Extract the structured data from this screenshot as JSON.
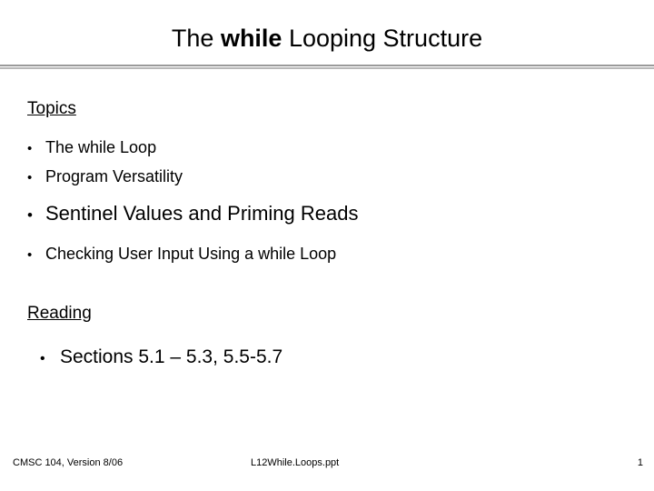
{
  "slide": {
    "title": {
      "before": "The ",
      "emphasis": "while",
      "after": " Looping Structure"
    },
    "topics_heading": "Topics",
    "topics": [
      {
        "bullet": "•",
        "text": "The while Loop",
        "size": "normal"
      },
      {
        "bullet": "•",
        "text": "Program Versatility",
        "size": "normal"
      },
      {
        "bullet": "•",
        "text": "Sentinel Values and Priming Reads",
        "size": "large"
      },
      {
        "bullet": "•",
        "text": "Checking User Input Using a while Loop",
        "size": "normal"
      }
    ],
    "reading_heading": "Reading",
    "reading": [
      {
        "bullet": "•",
        "text": "Sections 5.1 – 5.3, 5.5-5.7"
      }
    ],
    "footer": {
      "left": "CMSC 104, Version 8/06",
      "center": "L12While.Loops.ppt",
      "right": "1"
    }
  }
}
